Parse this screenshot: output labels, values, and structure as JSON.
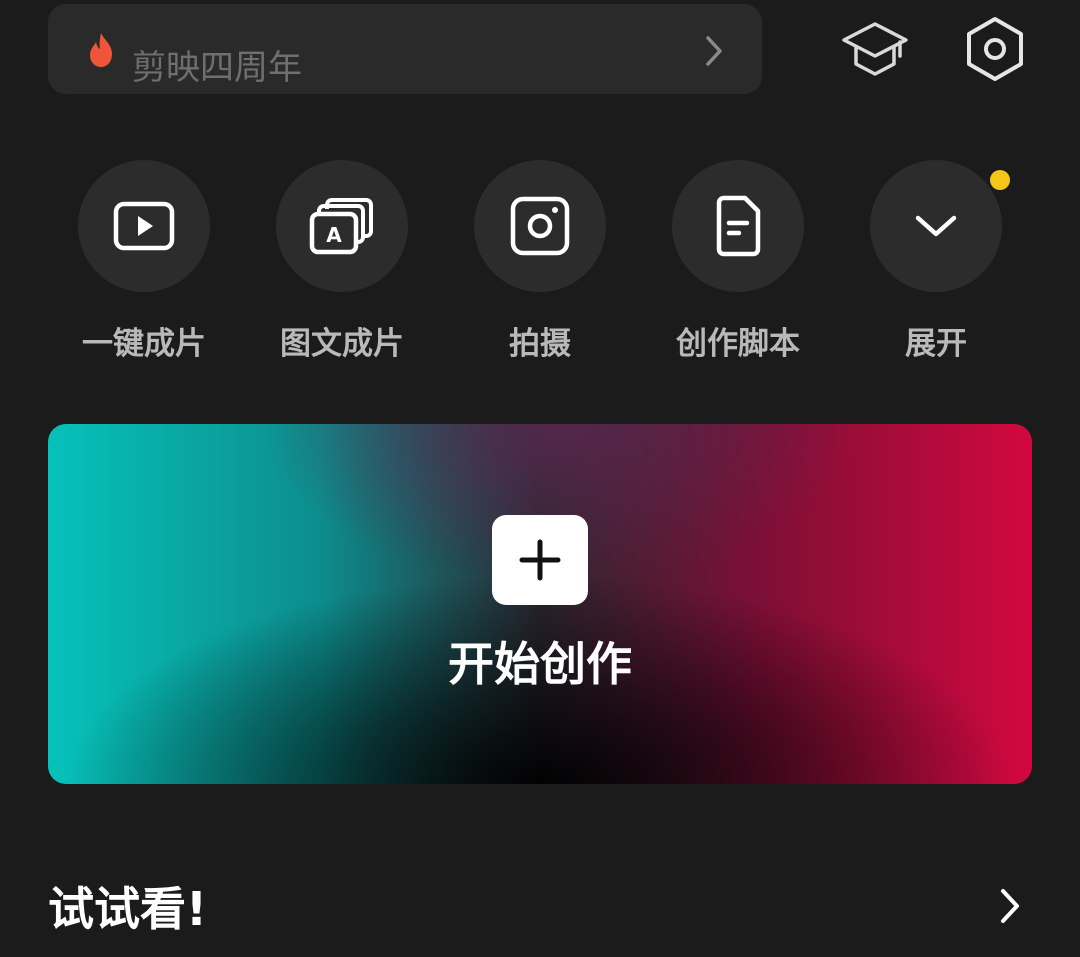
{
  "search": {
    "placeholder": "剪映四周年",
    "icon": "flame-icon",
    "trailing_icon": "chevron-right-icon"
  },
  "header_icons": [
    "graduation-cap-icon",
    "settings-hexagon-icon"
  ],
  "actions": [
    {
      "label": "一键成片",
      "icon": "play-video-icon"
    },
    {
      "label": "图文成片",
      "icon": "text-to-video-icon"
    },
    {
      "label": "拍摄",
      "icon": "camera-icon"
    },
    {
      "label": "创作脚本",
      "icon": "script-document-icon"
    },
    {
      "label": "展开",
      "icon": "chevron-down-icon",
      "badge": true
    }
  ],
  "create_card": {
    "label": "开始创作",
    "icon": "plus-icon"
  },
  "section": {
    "title": "试试看!",
    "trailing_icon": "chevron-right-icon"
  },
  "colors": {
    "background": "#1b1b1b",
    "surface": "#2a2a2a",
    "badge": "#f5c518",
    "flame": "#f0553a",
    "gradient_left": "#06c2ba",
    "gradient_right": "#d2083f"
  }
}
